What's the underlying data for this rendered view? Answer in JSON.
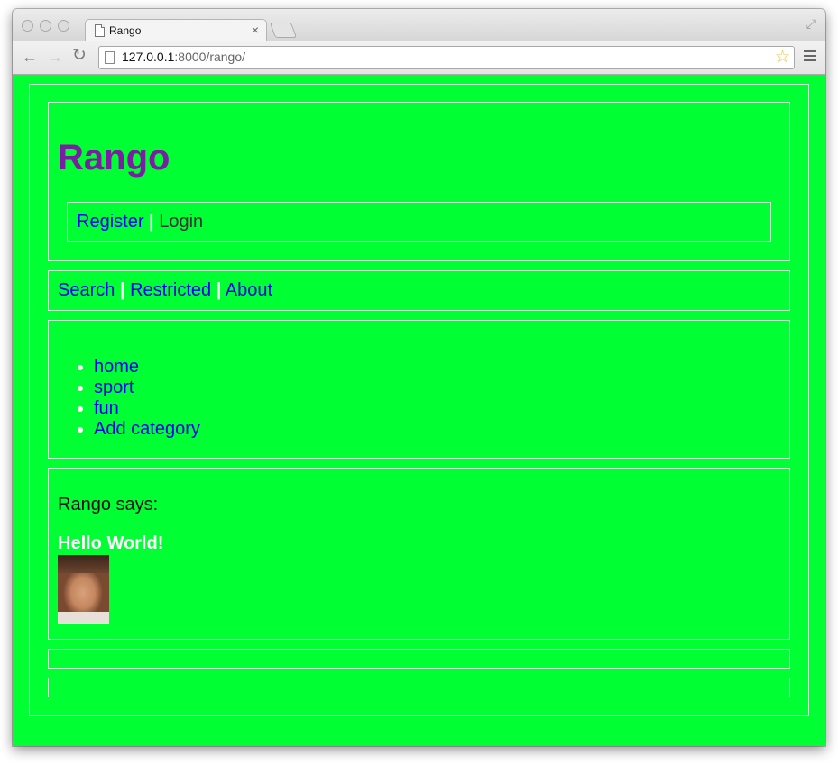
{
  "browser": {
    "tab_title": "Rango",
    "tab_close": "×",
    "url_host": "127.0.0.1",
    "url_rest": ":8000/rango/",
    "back": "←",
    "forward": "→",
    "reload": "↻",
    "star": "☆",
    "fullscreen": "⤢"
  },
  "page": {
    "heading": "Rango",
    "auth_links": {
      "register": "Register",
      "sep": "|",
      "login": "Login"
    },
    "nav_links": {
      "search": "Search",
      "sep1": "|",
      "restricted": "Restricted",
      "sep2": "|",
      "about": "About"
    },
    "categories": [
      "home",
      "sport",
      "fun",
      "Add category"
    ],
    "says_label": "Rango says:",
    "message": "Hello World!"
  },
  "colors": {
    "page_background": "#00ff33",
    "heading": "#7b1fa2",
    "link": "#0000ee",
    "separator": "#ffffff"
  },
  "icons": [
    "back-icon",
    "forward-icon",
    "reload-icon",
    "page-icon",
    "star-icon",
    "menu-icon",
    "close-icon",
    "fullscreen-icon"
  ]
}
